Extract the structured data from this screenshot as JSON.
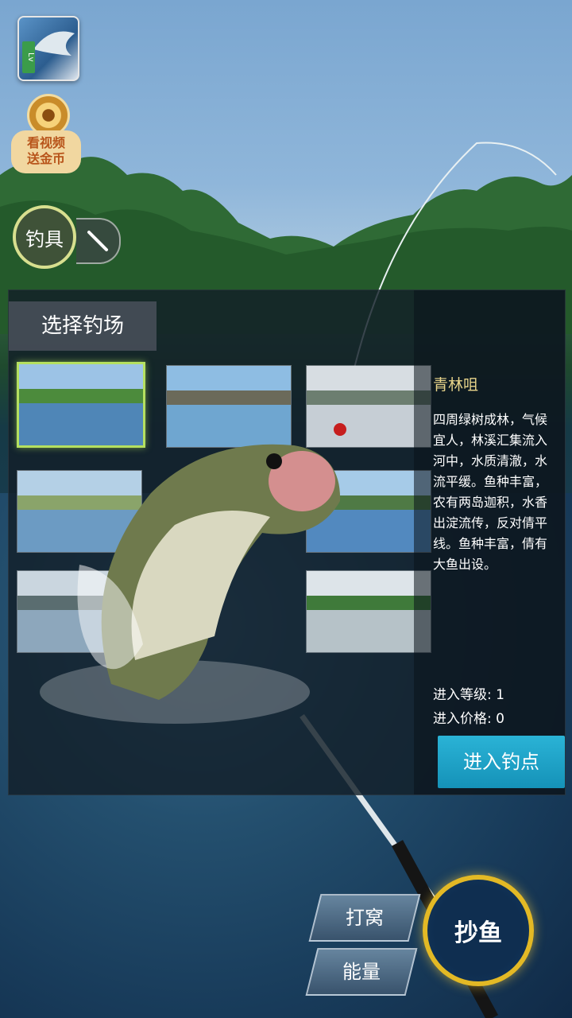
{
  "hud": {
    "gear_label": "钓具",
    "coin_label": "看视频\n送金币"
  },
  "panel": {
    "title": "选择钓场",
    "selected_index": 0,
    "spot": {
      "name": "青林咀",
      "description": "四周绿树成林，气候宜人，林溪汇集流入河中，水质清澈，水流平缓。鱼种丰富，农有两岛迦积，水香出淀流传，反对倩平线。鱼种丰富，倩有大鱼出设。",
      "level_label": "进入等级:",
      "level_value": "1",
      "price_label": "进入价格:",
      "price_value": "0",
      "enter_label": "进入钓点"
    }
  },
  "controls": {
    "chum_label": "打窝",
    "energy_label": "能量",
    "catch_label": "抄鱼"
  },
  "colors": {
    "accent": "#b5e060",
    "button": "#1ea3c8",
    "gold": "#e3b925"
  }
}
